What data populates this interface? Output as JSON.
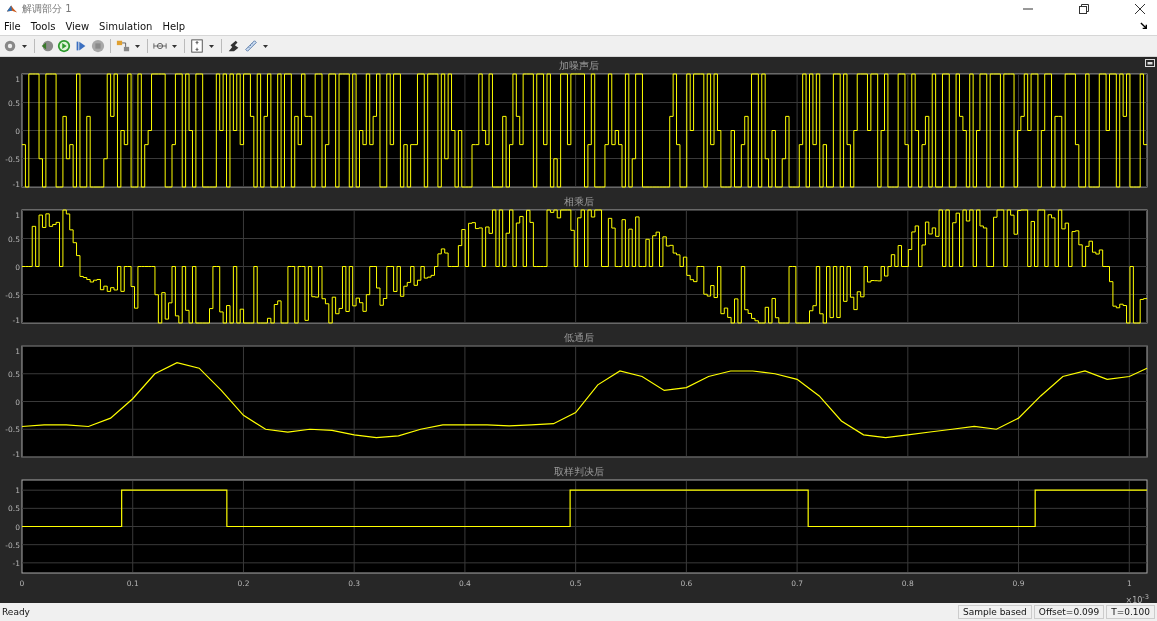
{
  "window": {
    "title": "解调部分 1"
  },
  "menu": [
    "File",
    "Tools",
    "View",
    "Simulation",
    "Help"
  ],
  "plots": [
    {
      "title": "加噪声后",
      "kind": "waveform",
      "y_tick_labels": [
        "1",
        "0.5",
        "0",
        "-0.5",
        "-1"
      ]
    },
    {
      "title": "相乘后",
      "kind": "waveform",
      "y_tick_labels": [
        "1",
        "0.5",
        "0",
        "-0.5",
        "-1"
      ]
    },
    {
      "title": "低通后",
      "kind": "chart",
      "chart_data": {
        "type": "line",
        "grid": true,
        "xlim": [
          0,
          1.016
        ],
        "ylim": [
          -1,
          1
        ],
        "yticks": [
          1,
          0.5,
          0,
          -0.5,
          -1
        ],
        "x": [
          0,
          0.02,
          0.04,
          0.06,
          0.08,
          0.1,
          0.12,
          0.14,
          0.16,
          0.18,
          0.2,
          0.22,
          0.24,
          0.26,
          0.28,
          0.3,
          0.32,
          0.34,
          0.36,
          0.38,
          0.4,
          0.42,
          0.44,
          0.46,
          0.48,
          0.5,
          0.52,
          0.54,
          0.56,
          0.58,
          0.6,
          0.62,
          0.64,
          0.66,
          0.68,
          0.7,
          0.72,
          0.74,
          0.76,
          0.78,
          0.8,
          0.82,
          0.84,
          0.86,
          0.88,
          0.9,
          0.92,
          0.94,
          0.96,
          0.98,
          1.0,
          1.016
        ],
        "series": [
          {
            "color": "#ffff00",
            "values": [
              -0.45,
              -0.42,
              -0.42,
              -0.45,
              -0.3,
              0.05,
              0.5,
              0.7,
              0.6,
              0.2,
              -0.25,
              -0.5,
              -0.55,
              -0.5,
              -0.52,
              -0.6,
              -0.65,
              -0.62,
              -0.5,
              -0.42,
              -0.42,
              -0.42,
              -0.44,
              -0.42,
              -0.4,
              -0.2,
              0.3,
              0.55,
              0.45,
              0.2,
              0.25,
              0.45,
              0.55,
              0.55,
              0.5,
              0.4,
              0.1,
              -0.35,
              -0.6,
              -0.65,
              -0.6,
              -0.55,
              -0.5,
              -0.45,
              -0.5,
              -0.3,
              0.1,
              0.45,
              0.55,
              0.4,
              0.45,
              0.6
            ]
          }
        ]
      }
    },
    {
      "title": "取样判决后",
      "kind": "chart",
      "x_exponent": "×10$^{-3}$",
      "chart_data": {
        "type": "line",
        "grid": true,
        "xlim": [
          0,
          1.016
        ],
        "ylim": [
          -1.28,
          1.28
        ],
        "yticks": [
          1,
          0.5,
          0,
          -0.5,
          -1
        ],
        "xticks": [
          0,
          0.1,
          0.2,
          0.3,
          0.4,
          0.5,
          0.6,
          0.7,
          0.8,
          0.9,
          1
        ],
        "x": [
          0,
          0.09,
          0.09,
          0.185,
          0.185,
          0.495,
          0.495,
          0.71,
          0.71,
          0.915,
          0.915,
          1.016
        ],
        "series": [
          {
            "color": "#ffff00",
            "values": [
              0,
              0,
              1,
              1,
              0,
              0,
              1,
              1,
              0,
              0,
              1,
              1
            ]
          }
        ]
      }
    }
  ],
  "status_bar": {
    "status": "Ready",
    "fields": [
      "Sample based",
      "Offset=0.099",
      "T=0.100"
    ]
  }
}
